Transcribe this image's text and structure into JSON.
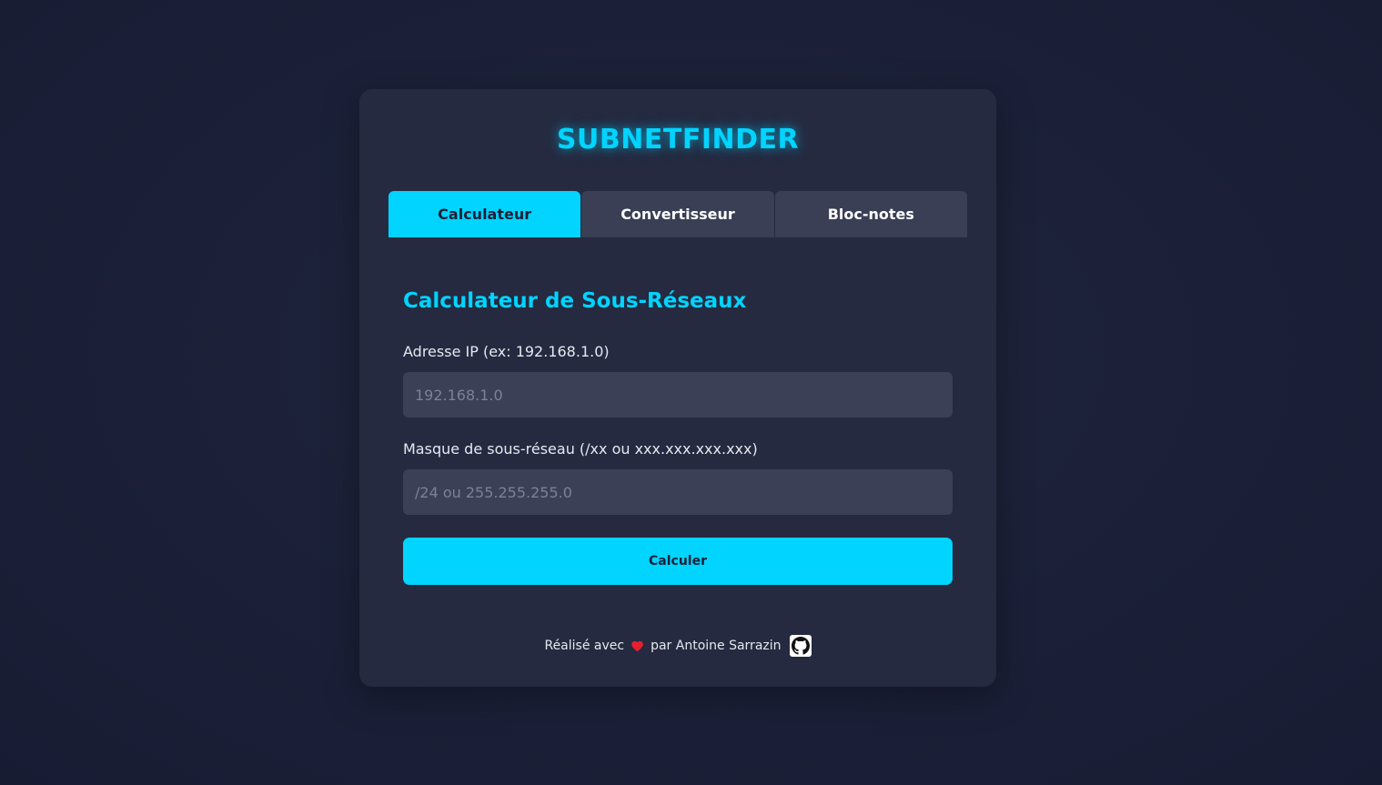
{
  "app": {
    "title": "SUBNETFINDER"
  },
  "tabs": [
    {
      "label": "Calculateur",
      "active": true
    },
    {
      "label": "Convertisseur",
      "active": false
    },
    {
      "label": "Bloc-notes",
      "active": false
    }
  ],
  "calculator": {
    "title": "Calculateur de Sous-Réseaux",
    "ip_label": "Adresse IP (ex: 192.168.1.0)",
    "ip_placeholder": "192.168.1.0",
    "ip_value": "",
    "mask_label": "Masque de sous-réseau (/xx ou xxx.xxx.xxx.xxx)",
    "mask_placeholder": "/24 ou 255.255.255.0",
    "mask_value": "",
    "submit_label": "Calculer"
  },
  "footer": {
    "text_before": "Réalisé avec",
    "text_after": "par Antoine Sarrazin",
    "heart_icon": "heart-icon",
    "github_icon": "github-icon"
  },
  "colors": {
    "accent": "#00d4ff",
    "background": "#1b2038",
    "card": "#252a40",
    "input": "#3c4056",
    "tab_inactive": "#3a3f55"
  }
}
